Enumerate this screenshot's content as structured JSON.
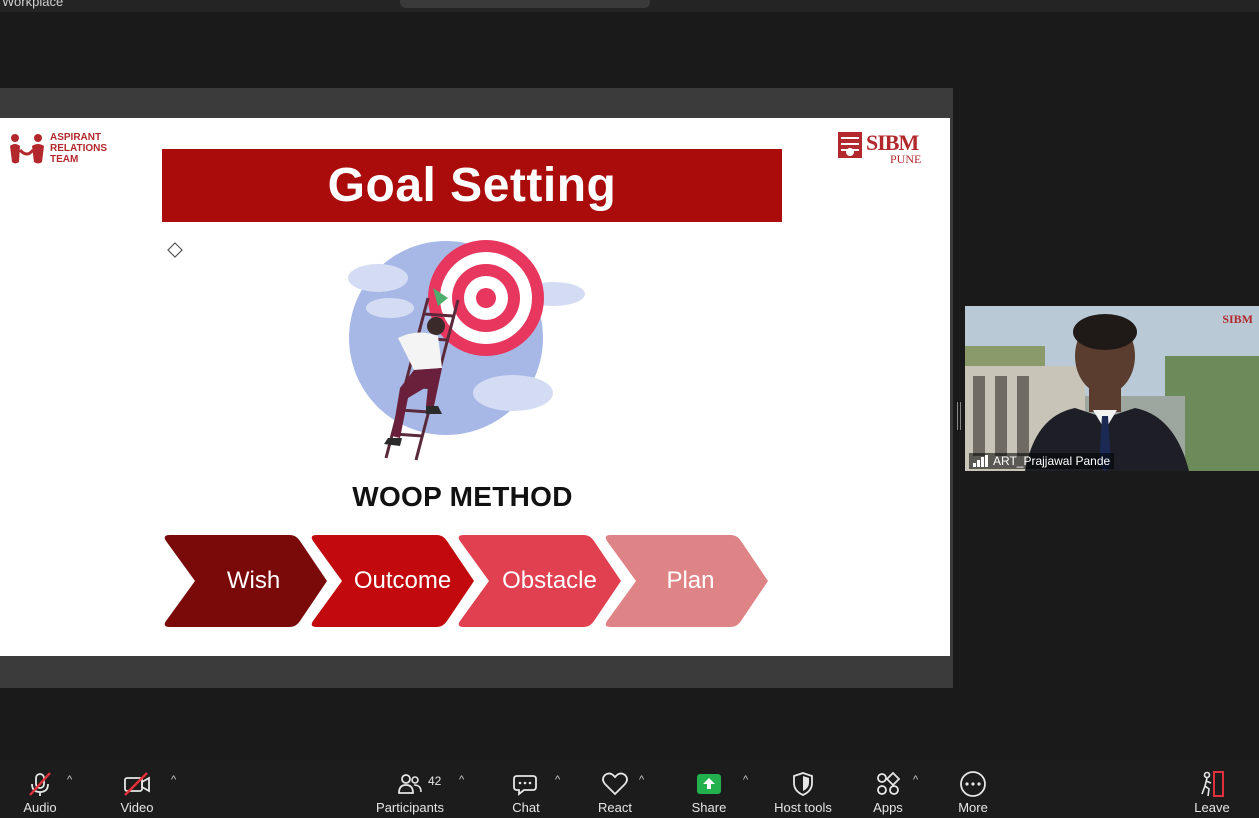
{
  "window": {
    "title": "Workplace"
  },
  "slide": {
    "left_logo_text": "ASPIRANT\nRELATIONS\nTEAM",
    "right_logo_name": "SIBM",
    "right_logo_city": "PUNE",
    "title": "Goal Setting",
    "subtitle": "WOOP METHOD",
    "steps": [
      {
        "label": "Wish",
        "color": "#7a0a0a"
      },
      {
        "label": "Outcome",
        "color": "#c20a0e"
      },
      {
        "label": "Obstacle",
        "color": "#e0404f"
      },
      {
        "label": "Plan",
        "color": "#df8486"
      }
    ]
  },
  "participant": {
    "name": "ART_Prajjawal Pande",
    "logo": "SIBM"
  },
  "toolbar": {
    "audio": "Audio",
    "video": "Video",
    "participants": "Participants",
    "participants_count": "42",
    "chat": "Chat",
    "react": "React",
    "share": "Share",
    "host_tools": "Host tools",
    "apps": "Apps",
    "more": "More",
    "leave": "Leave"
  },
  "colors": {
    "accent_red": "#aa0b0b",
    "share_green": "#22b14c"
  }
}
